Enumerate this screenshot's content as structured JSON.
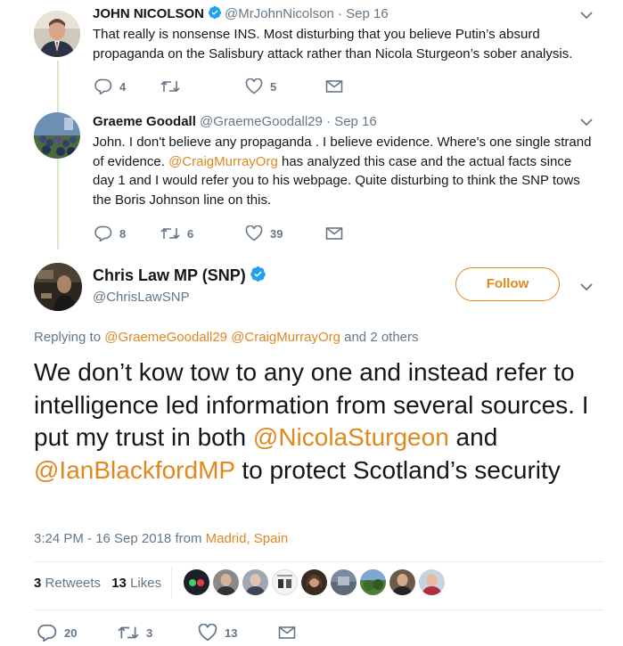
{
  "replies": [
    {
      "display_name": "JOHN NICOLSON",
      "handle": "@MrJohnNicolson",
      "time": "· Sep 16",
      "text": "That really is nonsense INS. Most disturbing that you believe Putin’s absurd propaganda on the Salisbury attack rather than Nicola Sturgeon’s sober analysis.",
      "replies_count": "4",
      "retweets_count": "",
      "likes_count": "5"
    },
    {
      "display_name": "Graeme Goodall",
      "handle": "@GraemeGoodall29",
      "time": "· Sep 16",
      "text_parts": [
        "John. I don't believe any propaganda . I believe evidence. Where's one single strand of evidence. ",
        "@CraigMurrayOrg",
        " has analyzed this case and the actual facts since day 1 and I would refer you to his webpage. Quite disturbing to think the SNP tows the Boris Johnson line on this."
      ],
      "replies_count": "8",
      "retweets_count": "6",
      "likes_count": "39"
    }
  ],
  "main_tweet": {
    "display_name": "Chris Law MP (SNP)",
    "handle": "@ChrisLawSNP",
    "follow_label": "Follow",
    "replying_to_prefix": "Replying to",
    "replying_to_user1": "@GraemeGoodall29",
    "replying_to_user2": "@CraigMurrayOrg",
    "replying_to_suffix": "and 2 others",
    "text_part1": "We don’t kow tow to any one and instead refer to intelligence led information from several sources.  I put my trust in both ",
    "mention1": "@NicolaSturgeon",
    "text_part2": " and ",
    "mention2": "@IanBlackfordMP",
    "text_part3": " to protect Scotland’s security",
    "timestamp": "3:24 PM - 16 Sep 2018 from",
    "location": "Madrid, Spain",
    "retweets_count": "3",
    "retweets_label": "Retweets",
    "likes_count": "13",
    "likes_label": "Likes",
    "replies_count": "20",
    "bottom_retweets": "3",
    "bottom_likes": "13"
  },
  "colors": {
    "link": "#e0871e",
    "muted": "#657786",
    "verified": "#1da1f2"
  }
}
